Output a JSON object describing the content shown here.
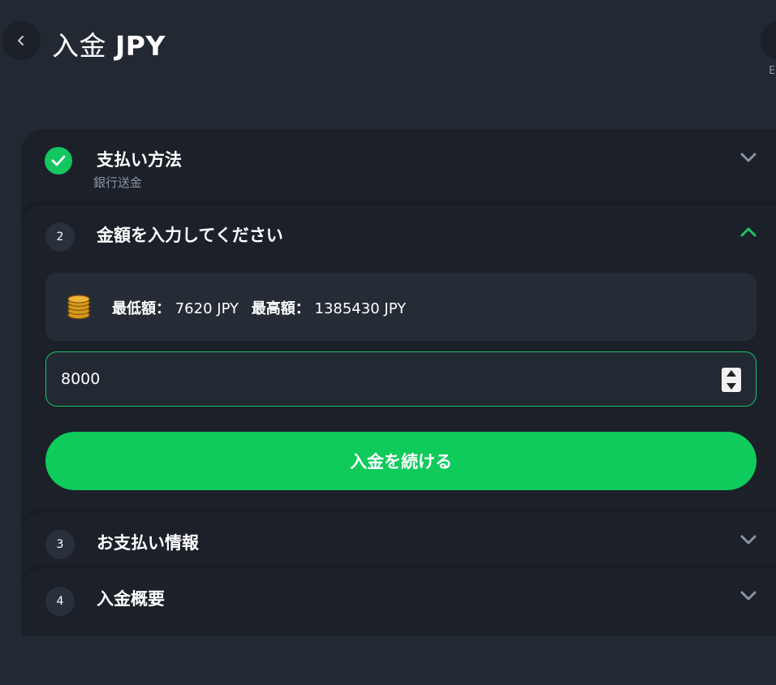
{
  "header": {
    "title_main": "入金",
    "title_currency": "JPY",
    "corner_label": "E"
  },
  "steps": [
    {
      "title": "支払い方法",
      "subtitle": "銀行送金",
      "status": "completed"
    },
    {
      "number": "2",
      "title": "金額を入力してください",
      "status": "active"
    },
    {
      "number": "3",
      "title": "お支払い情報",
      "status": "collapsed"
    },
    {
      "number": "4",
      "title": "入金概要",
      "status": "collapsed"
    }
  ],
  "limits": {
    "min_label": "最低額：",
    "min_value": "7620 JPY",
    "max_label": "最高額：",
    "max_value": "1385430 JPY",
    "icon": "coins-icon"
  },
  "amount_input": {
    "value": "8000"
  },
  "continue_button": {
    "label": "入金を続ける"
  },
  "colors": {
    "accent": "#0fcb5c",
    "background": "#232933",
    "panel": "#1b2029",
    "muted_text": "#8b93a1"
  }
}
